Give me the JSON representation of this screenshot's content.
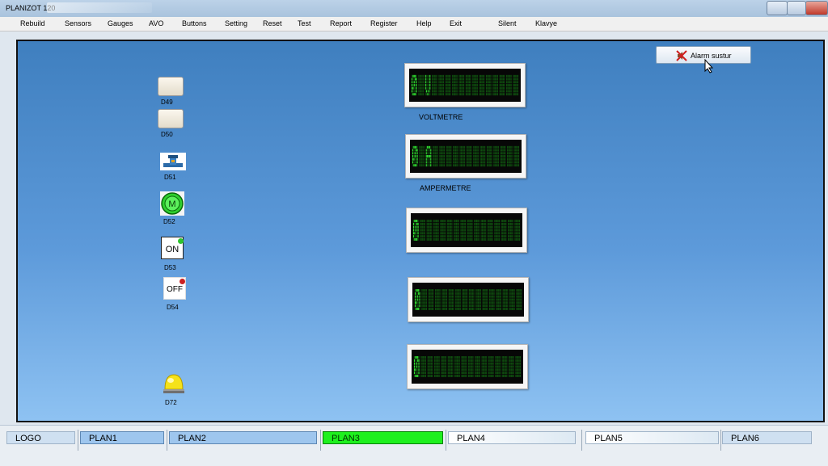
{
  "window": {
    "title": "PLANIZOT  120"
  },
  "menu": [
    "Rebuild",
    "Sensors",
    "Gauges",
    "AVO",
    "Buttons",
    "Setting",
    "Reset",
    "Test",
    "Report",
    "Register",
    "Help",
    "Exit",
    "Silent",
    "Klavye"
  ],
  "alarm_button": {
    "label": "Alarm sustur",
    "icon": "speaker-muted-icon"
  },
  "devices": [
    {
      "label": "D49",
      "type": "lamp"
    },
    {
      "label": "D50",
      "type": "lamp"
    },
    {
      "label": "D51",
      "type": "valve"
    },
    {
      "label": "D52",
      "type": "motor",
      "text": "M"
    },
    {
      "label": "D53",
      "type": "switch",
      "text": "ON",
      "dot_color": "#2fc42f"
    },
    {
      "label": "D54",
      "type": "switch",
      "text": "OFF",
      "dot_color": "#cc2222"
    },
    {
      "label": "D72",
      "type": "warning-beacon"
    }
  ],
  "displays": [
    {
      "value": "0 V",
      "label": "VOLTMETRE"
    },
    {
      "value": "0 A",
      "label": "AMPERMETRE"
    },
    {
      "value": "0",
      "label": ""
    },
    {
      "value": "0",
      "label": ""
    },
    {
      "value": "0",
      "label": ""
    }
  ],
  "tabs": [
    {
      "label": "LOGO",
      "style": "plain"
    },
    {
      "label": "PLAN1",
      "style": "blue"
    },
    {
      "label": "PLAN2",
      "style": "blue"
    },
    {
      "label": "PLAN3",
      "style": "active"
    },
    {
      "label": "PLAN4",
      "style": "pale"
    },
    {
      "label": "PLAN5",
      "style": "pale"
    },
    {
      "label": "PLAN6",
      "style": "plain"
    }
  ],
  "colors": {
    "lcd_on": "#32e632",
    "lcd_off": "#0f4d0f",
    "active_tab": "#1ef01e",
    "panel_top": "#3f7fbf",
    "panel_bottom": "#8ec2f2"
  }
}
